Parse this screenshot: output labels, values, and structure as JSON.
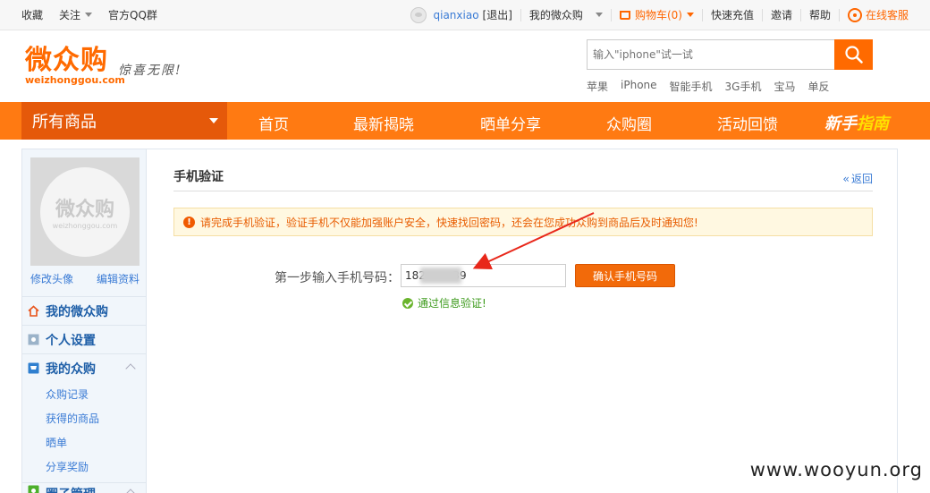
{
  "topbar": {
    "favorite": "收藏",
    "follow": "关注",
    "qq_group": "官方QQ群",
    "username": "qianxiao",
    "logout": "[退出]",
    "my_account": "我的微众购",
    "cart": "购物车(0)",
    "recharge": "快速充值",
    "invite": "邀请",
    "help": "帮助",
    "service": "在线客服"
  },
  "header": {
    "logo": "微众购",
    "logo_domain": "weizhonggou.com",
    "slogan": "惊喜无限!",
    "search_placeholder": "输入\"iphone\"试一试",
    "hotwords": [
      "苹果",
      "iPhone",
      "智能手机",
      "3G手机",
      "宝马",
      "单反"
    ]
  },
  "nav": {
    "all": "所有商品",
    "items": [
      "首页",
      "最新揭晓",
      "晒单分享",
      "众购圈",
      "活动回馈"
    ],
    "newbie_a": "新手",
    "newbie_b": "指南"
  },
  "sidebar": {
    "avatar_text": "微众购",
    "avatar_domain": "weizhonggou.com",
    "change_avatar": "修改头像",
    "edit_profile": "编辑资料",
    "menu": [
      "我的微众购",
      "个人设置",
      "我的众购"
    ],
    "submenu": [
      "众购记录",
      "获得的商品",
      "晒单",
      "分享奖励"
    ],
    "menu_cut": "圈子管理"
  },
  "main": {
    "title": "手机验证",
    "back": "返回",
    "notice": "请完成手机验证，验证手机不仅能加强账户安全，快速找回密码，还会在您成功众购到商品后及时通知您!",
    "step_label": "第一步输入手机号码：",
    "phone_value": "182        39",
    "confirm_button": "确认手机号码",
    "verified": "通过信息验证!"
  },
  "watermark": "www.wooyun.org",
  "colors": {
    "brand_orange": "#ff7a12",
    "link_blue": "#3a7bd5",
    "annotation_red": "#e8271a"
  }
}
